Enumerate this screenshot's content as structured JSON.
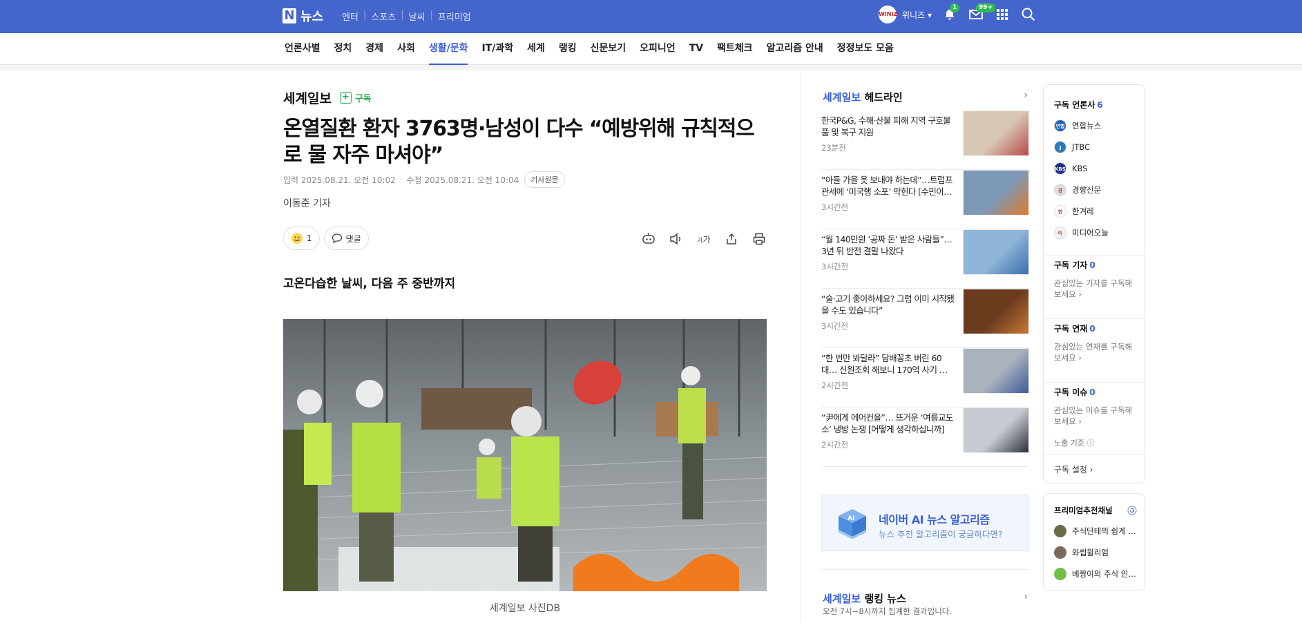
{
  "topbar": {
    "logo_letter": "N",
    "logo_text": "뉴스",
    "menu": [
      "엔터",
      "스포츠",
      "날씨",
      "프리미엄"
    ],
    "user_avatar_text": "WINIZ",
    "user_name": "위니즈",
    "notification_count": "1",
    "mail_count": "99+"
  },
  "nav": {
    "items": [
      "언론사별",
      "정치",
      "경제",
      "사회",
      "생활/문화",
      "IT/과학",
      "세계",
      "랭킹",
      "신문보기",
      "오피니언",
      "TV",
      "팩트체크",
      "알고리즘 안내",
      "정정보도 모음"
    ],
    "active_index": 4,
    "active_color": "#3a5fd8"
  },
  "article": {
    "press_name": "세계일보",
    "subscribe_label": "구독",
    "title": "온열질환 환자 3763명·남성이 다수 “예방위해 규칙적으로 물 자주 마셔야”",
    "input_date": "입력 2025.08.21. 오전 10:02",
    "edit_date": "수정 2025.08.21. 오전 10:04",
    "original_label": "기사원문",
    "reporter": "이동준 기자",
    "reaction_count": "1",
    "comment_label": "댓글",
    "font_size_label": "가",
    "subheading": "고온다습한 날씨, 다음 주 중반까지",
    "photo_caption": "세계일보 사진DB"
  },
  "headlines": {
    "brand": "세계일보",
    "title_suffix": "헤드라인",
    "items": [
      {
        "text": "한국P&G, 수해·산불 피해 지역 구호물품 및 복구 지원",
        "time": "23분전"
      },
      {
        "text": "“아들 가을 옷 보내야 하는데”…트럼프 관세에 ‘미국행 소포’ 막힌다 [수민이…",
        "time": "3시간전"
      },
      {
        "text": "“월 140만원 ‘공짜 돈’ 받은 사람들”…3년 뒤 반전 결말 나왔다",
        "time": "3시간전"
      },
      {
        "text": "“술·고기 좋아하세요? 그럼 이미 시작됐을 수도 있습니다”",
        "time": "3시간전"
      },
      {
        "text": "“한 번만 봐달라” 담배꽁초 버린 60대… 신원조회 해보니 170억 사기 …",
        "time": "2시간전"
      },
      {
        "text": "“尹에게 에어컨을”… 뜨거운 ‘여름교도소’ 냉방 논쟁 [어떻게 생각하십니까]",
        "time": "2시간전"
      }
    ]
  },
  "ai_banner": {
    "title": "네이버 AI 뉴스 알고리즘",
    "subtitle": "뉴스 추천 알고리즘이 궁금하다면?"
  },
  "ranking": {
    "brand": "세계일보",
    "title_suffix": "랭킹 뉴스",
    "subtitle": "오전 7시~8시까지 집계한 결과입니다."
  },
  "subscribe_panel": {
    "press_title": "구독 언론사",
    "press_count": "6",
    "press_list": [
      {
        "name": "연합뉴스",
        "color": "#1f5fb5",
        "mark": "연합"
      },
      {
        "name": "JTBC",
        "color": "#2a7ab8",
        "mark": "J"
      },
      {
        "name": "KBS",
        "color": "#1c2f8a",
        "mark": "KBS"
      },
      {
        "name": "경향신문",
        "color": "#dddddd",
        "mark": "경"
      },
      {
        "name": "한겨레",
        "color": "#ffffff",
        "mark": "한"
      },
      {
        "name": "미디어오늘",
        "color": "#f3f3f3",
        "mark": "미"
      }
    ],
    "reporter_title": "구독 기자",
    "reporter_count": "0",
    "reporter_desc": "관심있는 기자를 구독해보세요",
    "series_title": "구독 연재",
    "series_count": "0",
    "series_desc": "관심있는 연재를 구독해보세요",
    "issue_title": "구독 이슈",
    "issue_count": "0",
    "issue_desc": "관심있는 이슈를 구독해보세요",
    "exposure_label": "노출 기준",
    "settings_label": "구독 설정"
  },
  "premium": {
    "title": "프리미엄추천채널",
    "channels": [
      "주식단테의 쉽게 …",
      "와썹윌리엄",
      "베짱이의 주식 인…"
    ]
  }
}
